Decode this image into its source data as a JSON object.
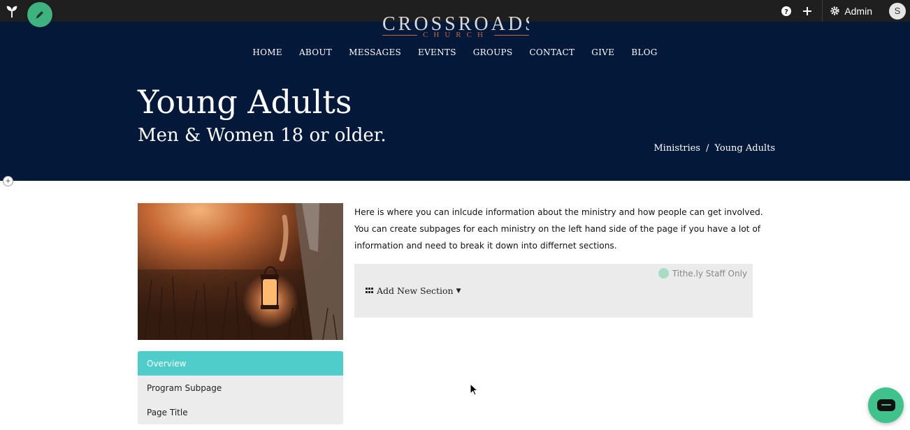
{
  "admin_bar": {
    "admin_label": "Admin",
    "avatar_initial": "S",
    "help_glyph": "?",
    "plus_glyph": "+"
  },
  "logo": {
    "name": "CROSSROADS",
    "subtitle": "CHURCH"
  },
  "nav": {
    "items": [
      "HOME",
      "ABOUT",
      "MESSAGES",
      "EVENTS",
      "GROUPS",
      "CONTACT",
      "GIVE",
      "BLOG"
    ]
  },
  "hero": {
    "title": "Young Adults",
    "subtitle": "Men & Women 18 or older."
  },
  "breadcrumb": {
    "parent": "Ministries",
    "separator": "/",
    "current": "Young Adults"
  },
  "content": {
    "body": "Here is where you can inlcude information about the ministry and how people can get involved. You can create subpages for each ministry on the left hand side of the page if you have a lot of information and need to break it down into differnet sections."
  },
  "section_editor": {
    "staff_only_label": "Tithe.ly Staff Only",
    "add_section_label": "Add New Section"
  },
  "subnav": {
    "items": [
      {
        "label": "Overview",
        "active": true
      },
      {
        "label": "Program Subpage",
        "active": false
      },
      {
        "label": "Page Title",
        "active": false
      }
    ]
  },
  "colors": {
    "hero_bg": "#04193a",
    "accent_teal": "#4ecdcb",
    "accent_green": "#3fc28b",
    "logo_copper": "#c0683e"
  },
  "icons": {
    "brand": "sprout-icon",
    "edit": "pencil-icon",
    "help": "question-circle-icon",
    "add": "plus-icon",
    "settings": "gear-icon",
    "chat": "chat-bubble-icon",
    "grid": "grid-icon"
  }
}
